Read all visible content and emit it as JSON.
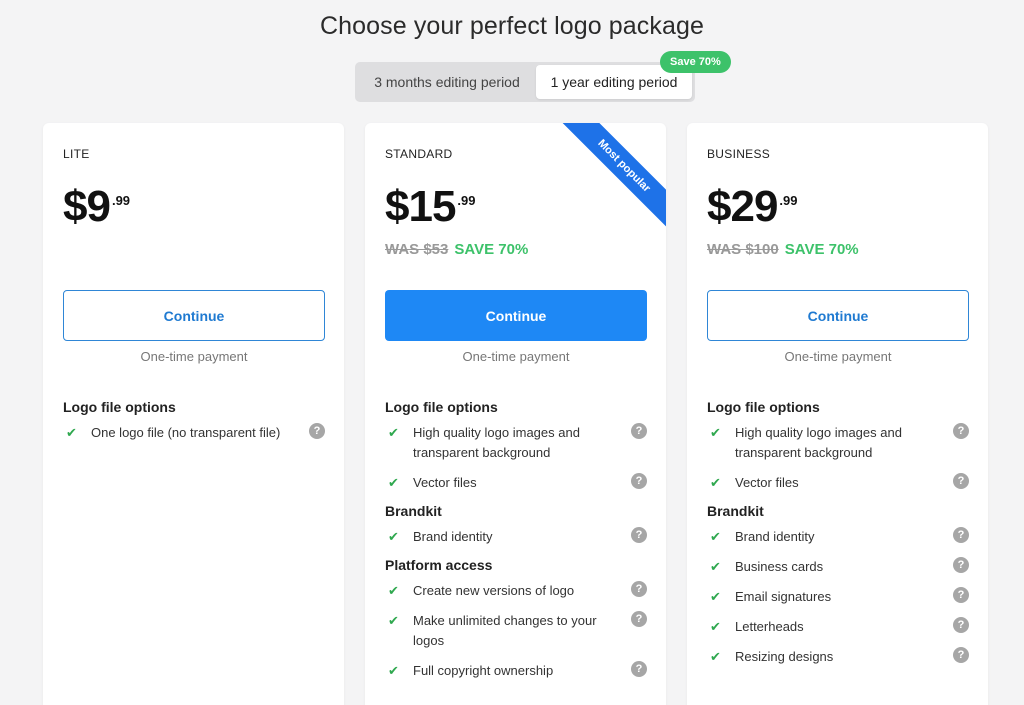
{
  "page": {
    "title": "Choose your perfect logo package"
  },
  "period_toggle": {
    "options": [
      "3 months editing period",
      "1 year editing period"
    ],
    "selected": "1 year editing period",
    "badge": "Save 70%"
  },
  "colors": {
    "accent": "#1e88f5",
    "save_green": "#3dc26a",
    "check_green": "#2fa84f",
    "ribbon": "#1e72e8"
  },
  "plans": [
    {
      "tier": "LITE",
      "price_main": "$9",
      "price_cents": ".99",
      "was": "",
      "save": "",
      "cta": "Continue",
      "cta_style": "outline",
      "payment_note": "One-time payment",
      "sections": [
        {
          "title": "Logo file options",
          "features": [
            "One logo file (no transparent file)"
          ]
        }
      ]
    },
    {
      "tier": "STANDARD",
      "price_main": "$15",
      "price_cents": ".99",
      "was": "WAS $53",
      "save": "SAVE 70%",
      "ribbon": "Most popular",
      "cta": "Continue",
      "cta_style": "filled",
      "payment_note": "One-time payment",
      "sections": [
        {
          "title": "Logo file options",
          "features": [
            "High quality logo images and transparent background",
            "Vector files"
          ]
        },
        {
          "title": "Brandkit",
          "features": [
            "Brand identity"
          ]
        },
        {
          "title": "Platform access",
          "features": [
            "Create new versions of logo",
            "Make unlimited changes to your logos",
            "Full copyright ownership"
          ]
        }
      ]
    },
    {
      "tier": "BUSINESS",
      "price_main": "$29",
      "price_cents": ".99",
      "was": "WAS $100",
      "save": "SAVE 70%",
      "cta": "Continue",
      "cta_style": "outline",
      "payment_note": "One-time payment",
      "sections": [
        {
          "title": "Logo file options",
          "features": [
            "High quality logo images and transparent background",
            "Vector files"
          ]
        },
        {
          "title": "Brandkit",
          "features": [
            "Brand identity",
            "Business cards",
            "Email signatures",
            "Letterheads",
            "Resizing designs"
          ]
        }
      ]
    }
  ],
  "icons": {
    "check": "check-icon",
    "help": "help-icon"
  }
}
